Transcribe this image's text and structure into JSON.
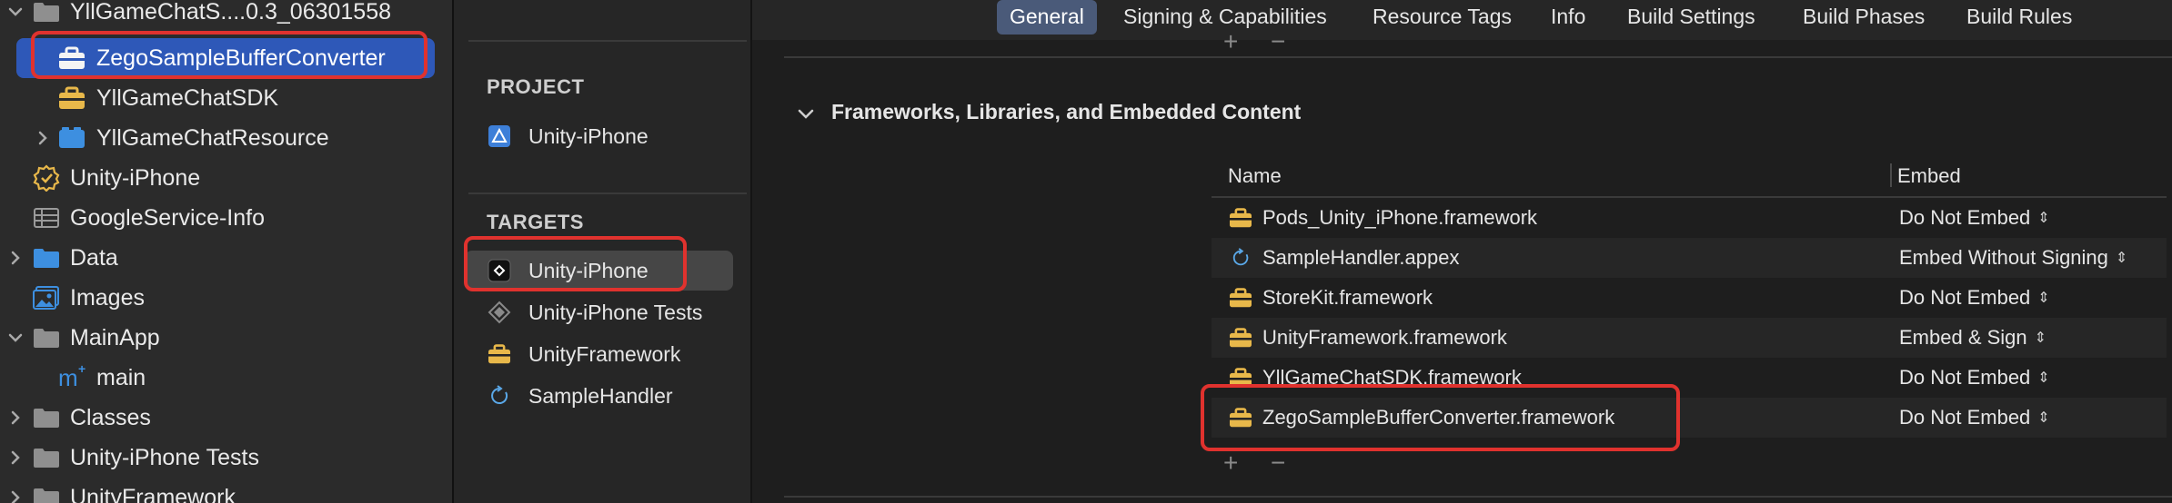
{
  "navigator": {
    "items": [
      {
        "label": "YllGameChatS....0.3_06301558",
        "icon": "folder-icon",
        "chevron": "down"
      },
      {
        "label": "ZegoSampleBufferConverter",
        "icon": "toolbox-icon",
        "chevron": "none",
        "selected": true
      },
      {
        "label": "YllGameChatSDK",
        "icon": "toolbox-icon",
        "chevron": "none"
      },
      {
        "label": "YllGameChatResource",
        "icon": "bundle-icon",
        "chevron": "right"
      },
      {
        "label": "Unity-iPhone",
        "icon": "badge-icon",
        "chevron": "none"
      },
      {
        "label": "GoogleService-Info",
        "icon": "plist-icon",
        "chevron": "none"
      },
      {
        "label": "Data",
        "icon": "folder-icon",
        "chevron": "right"
      },
      {
        "label": "Images",
        "icon": "image-asset-icon",
        "chevron": "none"
      },
      {
        "label": "MainApp",
        "icon": "folder-icon",
        "chevron": "down"
      },
      {
        "label": "main",
        "icon": "objc-file-icon",
        "chevron": "none"
      },
      {
        "label": "Classes",
        "icon": "folder-icon",
        "chevron": "right"
      },
      {
        "label": "Unity-iPhone Tests",
        "icon": "folder-icon",
        "chevron": "right"
      },
      {
        "label": "UnityFramework",
        "icon": "folder-icon",
        "chevron": "right"
      }
    ]
  },
  "targets_panel": {
    "project_heading": "PROJECT",
    "project_item": "Unity-iPhone",
    "targets_heading": "TARGETS",
    "targets": [
      {
        "label": "Unity-iPhone",
        "icon": "unity-app-icon",
        "selected": true
      },
      {
        "label": "Unity-iPhone Tests",
        "icon": "test-target-icon"
      },
      {
        "label": "UnityFramework",
        "icon": "toolbox-icon"
      },
      {
        "label": "SampleHandler",
        "icon": "extension-icon"
      }
    ]
  },
  "tabs": [
    {
      "label": "General",
      "active": true
    },
    {
      "label": "Signing & Capabilities"
    },
    {
      "label": "Resource Tags"
    },
    {
      "label": "Info"
    },
    {
      "label": "Build Settings"
    },
    {
      "label": "Build Phases"
    },
    {
      "label": "Build Rules"
    }
  ],
  "frameworks_section": {
    "title": "Frameworks, Libraries, and Embedded Content",
    "columns": {
      "name": "Name",
      "embed": "Embed"
    },
    "rows": [
      {
        "name": "Pods_Unity_iPhone.framework",
        "embed": "Do Not Embed",
        "icon": "toolbox-icon"
      },
      {
        "name": "SampleHandler.appex",
        "embed": "Embed Without Signing",
        "icon": "extension-icon"
      },
      {
        "name": "StoreKit.framework",
        "embed": "Do Not Embed",
        "icon": "toolbox-icon"
      },
      {
        "name": "UnityFramework.framework",
        "embed": "Embed & Sign",
        "icon": "toolbox-icon"
      },
      {
        "name": "YllGameChatSDK.framework",
        "embed": "Do Not Embed",
        "icon": "toolbox-icon"
      },
      {
        "name": "ZegoSampleBufferConverter.framework",
        "embed": "Do Not Embed",
        "icon": "toolbox-icon"
      }
    ],
    "add_label": "+",
    "remove_label": "−"
  },
  "colors": {
    "selection_blue": "#2e58b8",
    "annotation_red": "#e0322e",
    "folder_blue": "#3d8fe0",
    "toolbox_yellow": "#e8b84a"
  }
}
